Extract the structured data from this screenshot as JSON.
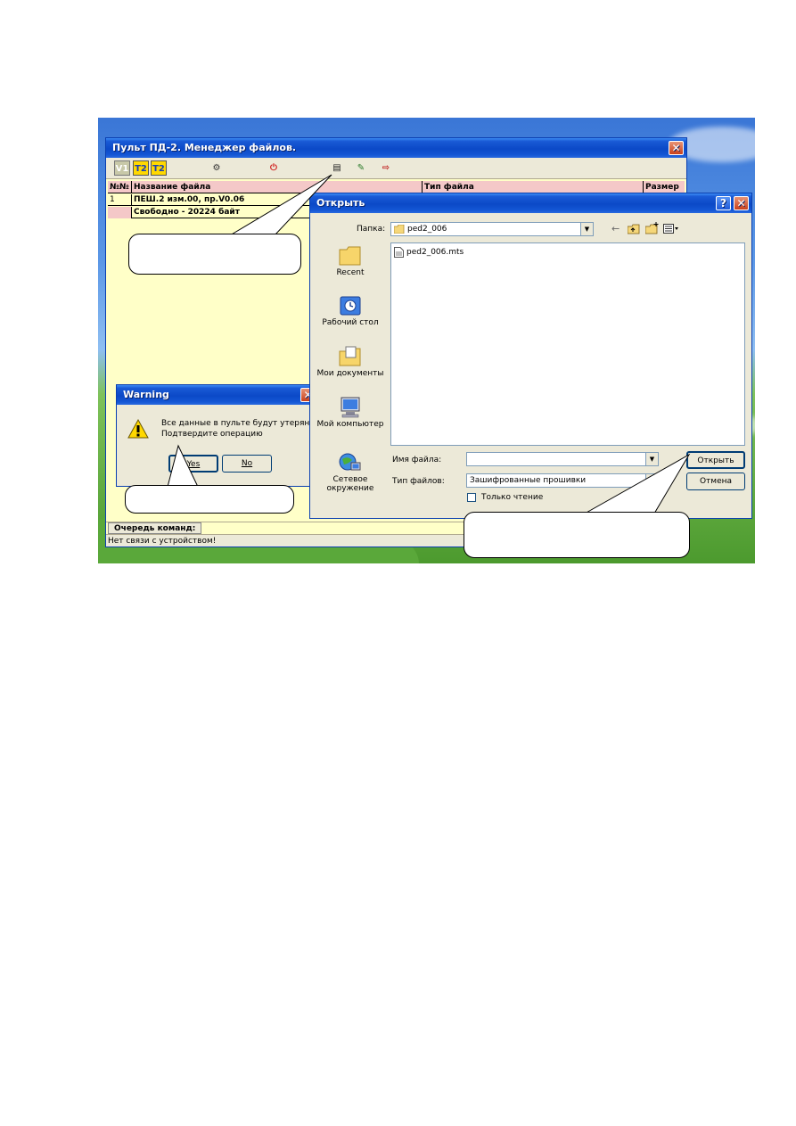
{
  "main_window": {
    "title": "Пульт ПД-2. Менеджер файлов.",
    "close_glyph": "✕",
    "toolbar": {
      "buttons": [
        {
          "name": "device-v1",
          "glyph": "V1"
        },
        {
          "name": "device-t2a",
          "glyph": "T2"
        },
        {
          "name": "device-t2b",
          "glyph": "T2"
        },
        {
          "name": "settings",
          "glyph": "⚙"
        },
        {
          "name": "reset",
          "glyph": "⏻"
        },
        {
          "name": "load-file",
          "glyph": "▤"
        },
        {
          "name": "edit",
          "glyph": "✎"
        },
        {
          "name": "export",
          "glyph": "⇨"
        }
      ]
    },
    "table": {
      "columns": [
        "№№",
        "Название файла",
        "Тип файла",
        "Размер"
      ],
      "rows": [
        {
          "num": "1",
          "name": "ПЕШ.2 изм.00, пр.V0.06"
        },
        {
          "num": "",
          "name": "Свободно - 20224 байт"
        }
      ]
    },
    "queue_label": "Очередь команд:",
    "status": "Нет связи с устройством!"
  },
  "warning_dialog": {
    "title": "Warning",
    "close_glyph": "✕",
    "message_line1": "Все данные в пульте будут утеряны!",
    "message_line2": "Подтвердите операцию",
    "yes_label": "Yes",
    "no_label": "No"
  },
  "open_dialog": {
    "title": "Открыть",
    "help_glyph": "?",
    "close_glyph": "✕",
    "folder_label": "Папка:",
    "folder_value": "ped2_006",
    "places": [
      "Recent",
      "Рабочий стол",
      "Мои документы",
      "Мой компьютер",
      "Сетевое окружение"
    ],
    "files": [
      "ped2_006.mts"
    ],
    "filename_label": "Имя файла:",
    "filename_value": "",
    "filetype_label": "Тип файлов:",
    "filetype_value": "Зашифрованные прошивки",
    "readonly_label": "Только чтение",
    "open_button": "Открыть",
    "cancel_button": "Отмена"
  },
  "colors": {
    "titlebar": "#0b49c7",
    "window_bg": "#ffffc8",
    "grid_header": "#f4c8c8",
    "dialog_bg": "#ece9d8",
    "close_button": "#c8401c"
  }
}
